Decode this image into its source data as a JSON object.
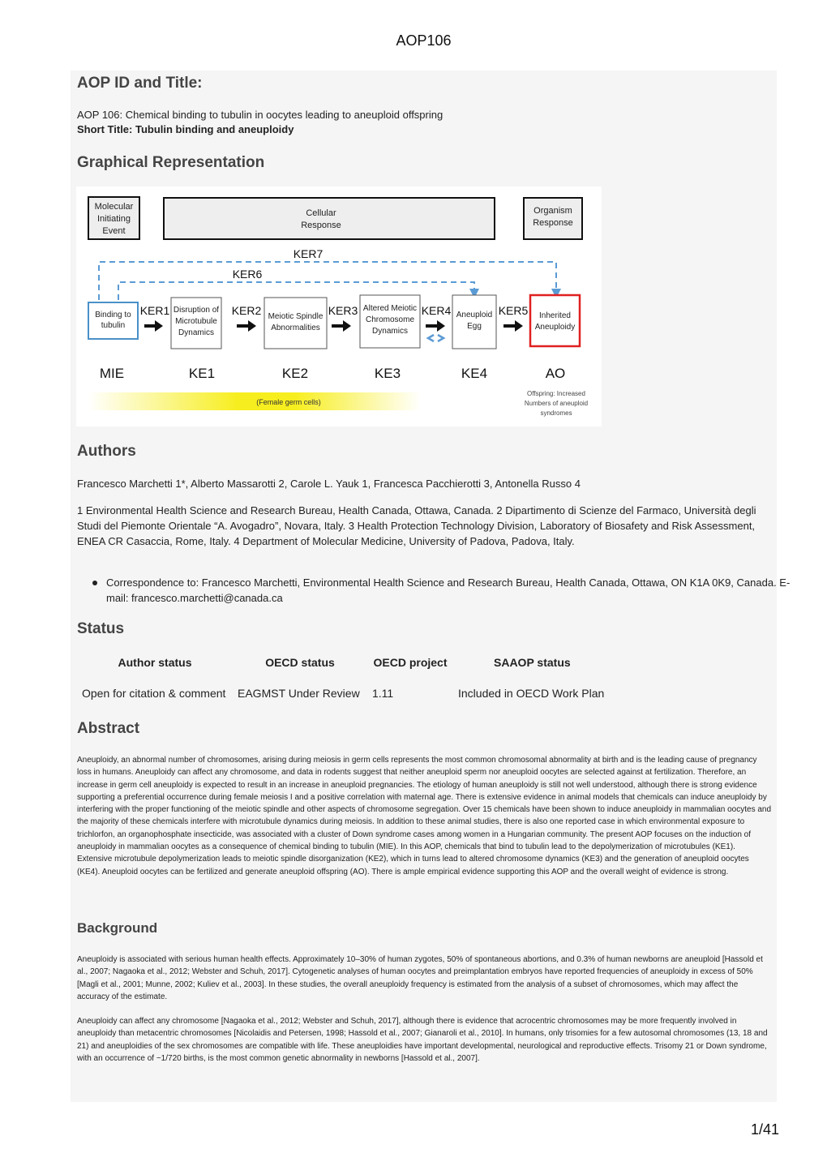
{
  "header": {
    "title": "AOP106"
  },
  "sections": {
    "aop_id": {
      "heading": "AOP ID and Title:",
      "title_line": "AOP 106: Chemical binding to tubulin in oocytes leading to aneuploid offspring",
      "short_title": "Short Title: Tubulin binding and aneuploidy"
    },
    "graphical": {
      "heading": "Graphical Representation",
      "diagram": {
        "level_boxes": [
          "Molecular Initiating Event",
          "Cellular Response",
          "Organism Response"
        ],
        "ker7": "KER7",
        "ker6": "KER6",
        "events": [
          {
            "label": "Binding to tubulin",
            "tag": "MIE"
          },
          {
            "label": "Disruption of Microtubule Dynamics",
            "tag": "KE1"
          },
          {
            "label": "Meiotic Spindle Abnormalities",
            "tag": "KE2"
          },
          {
            "label": "Altered Meiotic Chromosome Dynamics",
            "tag": "KE3"
          },
          {
            "label": "Aneuploid Egg",
            "tag": "KE4"
          },
          {
            "label": "Inherited Aneuploidy",
            "tag": "AO"
          }
        ],
        "kers": [
          "KER1",
          "KER2",
          "KER3",
          "KER4",
          "KER5"
        ],
        "gradient_label": "(Female germ cells)",
        "ao_note": [
          "Offspring: Increased",
          "Numbers of aneuploid",
          "syndromes"
        ],
        "colors": {
          "mie_border": "#4a90c8",
          "ao_border": "#e02020",
          "dashed": "#5b9bd5",
          "gradient": "#f7ee1f"
        }
      }
    },
    "authors": {
      "heading": "Authors",
      "names": "Francesco Marchetti 1*, Alberto Massarotti 2, Carole L. Yauk 1, Francesca Pacchierotti 3, Antonella Russo 4",
      "affiliations": "1 Environmental Health Science and Research Bureau, Health Canada, Ottawa, Canada. 2 Dipartimento di Scienze del Farmaco, Università degli Studi del Piemonte Orientale “A. Avogadro”, Novara, Italy. 3 Health Protection Technology Division, Laboratory of Biosafety and Risk Assessment, ENEA CR Casaccia, Rome, Italy. 4 Department of Molecular Medicine, University of Padova, Padova, Italy.",
      "correspondence": "Correspondence to: Francesco Marchetti, Environmental Health Science and Research Bureau, Health Canada, Ottawa, ON K1A 0K9, Canada. E-mail: francesco.marchetti@canada.ca"
    },
    "status": {
      "heading": "Status",
      "columns": [
        "Author status",
        "OECD status",
        "OECD project",
        "SAAOP status"
      ],
      "row": [
        "Open for citation & comment",
        "EAGMST Under Review",
        "1.11",
        "Included in OECD Work Plan"
      ]
    },
    "abstract": {
      "heading": "Abstract",
      "text": "Aneuploidy, an abnormal number of chromosomes, arising during meiosis in germ cells represents the most common chromosomal abnormality at birth and is the leading cause of pregnancy loss in humans. Aneuploidy can affect any chromosome, and data in rodents suggest that neither aneuploid sperm nor aneuploid oocytes are selected against at fertilization. Therefore, an increase in germ cell aneuploidy is expected to result in an increase in aneuploid pregnancies. The etiology of human aneuploidy is still not well understood, although there is strong evidence supporting a preferential occurrence during female meiosis I and a positive correlation with maternal age. There is extensive evidence in animal models that chemicals can induce aneuploidy by interfering with the proper functioning of the meiotic spindle and other aspects of chromosome segregation. Over 15 chemicals have been shown to induce aneuploidy in mammalian oocytes and the majority of these chemicals interfere with microtubule dynamics during meiosis. In addition to these animal studies, there is also one reported case in which environmental exposure to trichlorfon, an organophosphate insecticide, was associated with a cluster of Down syndrome cases among women in a Hungarian community. The present AOP focuses on the induction of aneuploidy in mammalian oocytes as a consequence of chemical binding to tubulin (MIE). In this AOP, chemicals that bind to tubulin lead to the depolymerization of microtubules (KE1). Extensive microtubule depolymerization leads to meiotic spindle disorganization (KE2), which in turns lead to altered chromosome dynamics (KE3) and the generation of aneuploid oocytes (KE4). Aneuploid oocytes can be fertilized and generate aneuploid offspring (AO). There is ample empirical evidence supporting this AOP and the overall weight of evidence is strong."
    },
    "background": {
      "heading": "Background",
      "p1": "Aneuploidy is associated with serious human health effects. Approximately 10–30% of human zygotes, 50% of spontaneous abortions, and 0.3% of human newborns are aneuploid [Hassold et al., 2007; Nagaoka et al., 2012; Webster and Schuh, 2017]. Cytogenetic analyses of human oocytes and preimplantation embryos have reported frequencies of aneuploidy in excess of 50% [Magli et al., 2001; Munne, 2002; Kuliev et al., 2003]. In these studies, the overall aneuploidy frequency is estimated from the analysis of a subset of chromosomes, which may affect the accuracy of the estimate.",
      "p2": "Aneuploidy can affect any chromosome [Nagaoka et al., 2012; Webster and Schuh, 2017], although there is evidence that acrocentric chromosomes may be more frequently involved in aneuploidy than metacentric chromosomes [Nicolaidis and Petersen, 1998; Hassold et al., 2007; Gianaroli et al., 2010]. In humans, only trisomies for a few autosomal chromosomes (13, 18 and 21) and aneuploidies of the sex chromosomes are compatible with life. These aneuploidies have important developmental, neurological and reproductive effects. Trisomy 21 or Down syndrome, with an occurrence of ~1/720 births, is the most common genetic abnormality in newborns [Hassold et al., 2007]."
    }
  },
  "footer": {
    "page": "1/41"
  }
}
